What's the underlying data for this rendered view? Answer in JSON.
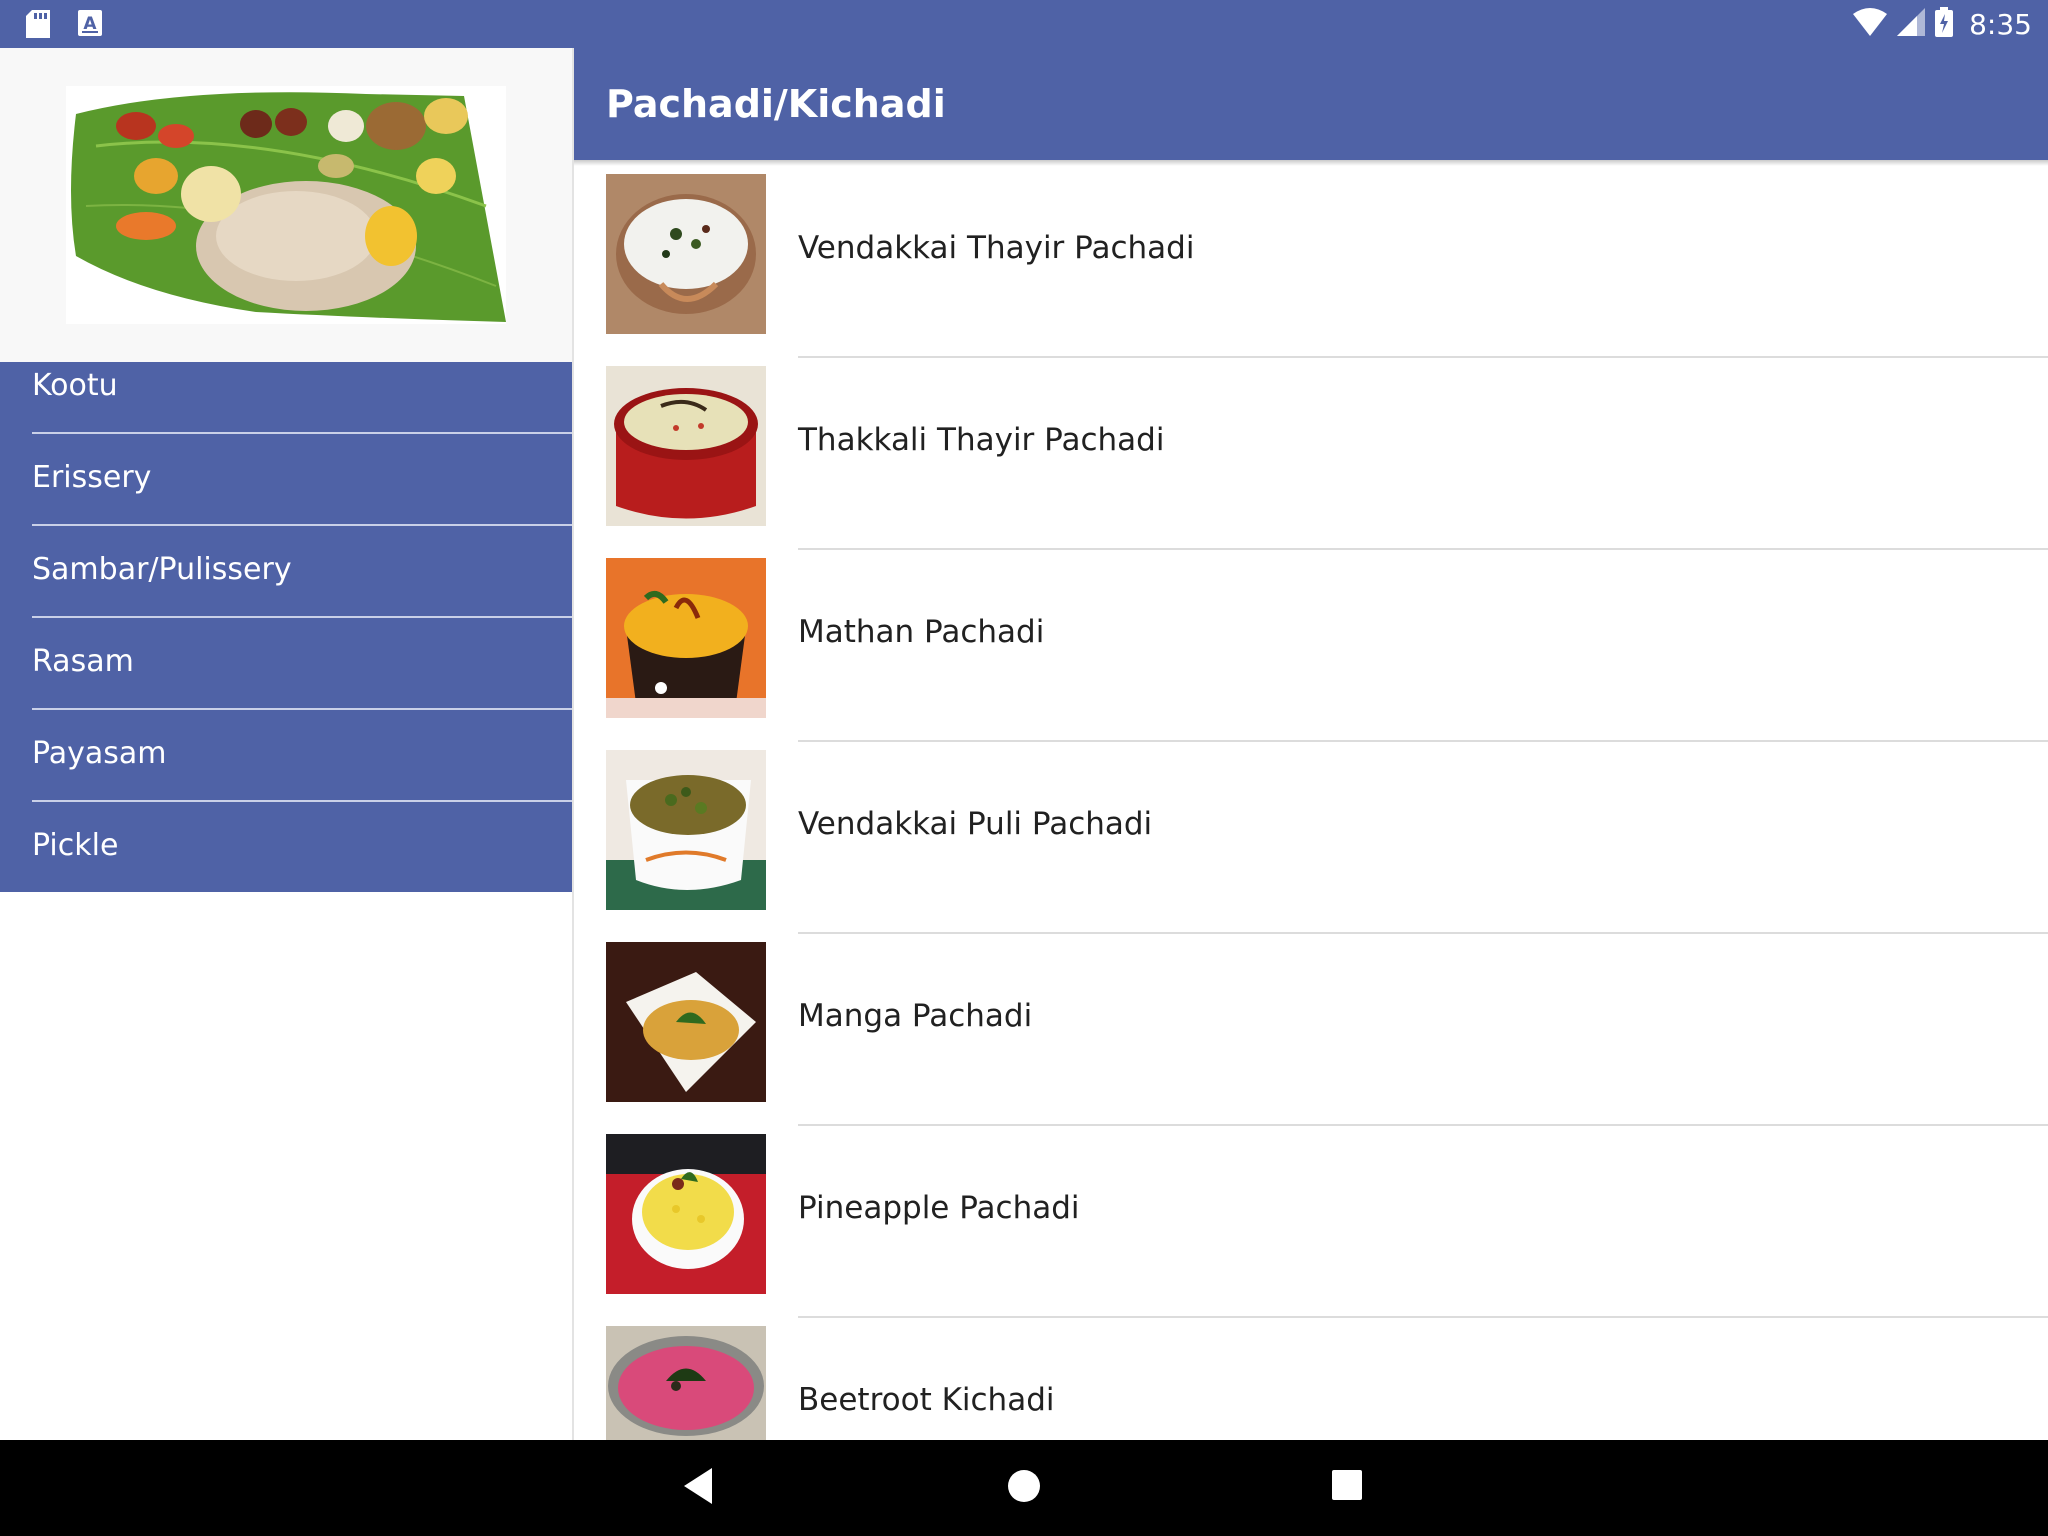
{
  "status_bar": {
    "time": "8:35",
    "icons": [
      "sd-card-icon",
      "keyboard-a-icon",
      "wifi-icon",
      "signal-icon",
      "battery-charging-icon"
    ]
  },
  "drawer": {
    "header_image": "onam-sadya-banana-leaf-image",
    "items": [
      {
        "label": "Kootu"
      },
      {
        "label": "Erissery"
      },
      {
        "label": "Sambar/Pulissery"
      },
      {
        "label": "Rasam"
      },
      {
        "label": "Payasam"
      },
      {
        "label": "Pickle"
      }
    ]
  },
  "toolbar": {
    "title": "Pachadi/Kichadi"
  },
  "recipes": [
    {
      "name": "Vendakkai Thayir Pachadi",
      "image": "curd-okra-bowl-image"
    },
    {
      "name": "Thakkali Thayir Pachadi",
      "image": "tomato-curd-pot-image"
    },
    {
      "name": "Mathan Pachadi",
      "image": "pumpkin-pachadi-image"
    },
    {
      "name": "Vendakkai Puli Pachadi",
      "image": "okra-tamarind-bowl-image"
    },
    {
      "name": "Manga Pachadi",
      "image": "mango-pachadi-image"
    },
    {
      "name": "Pineapple Pachadi",
      "image": "pineapple-pachadi-image"
    },
    {
      "name": "Beetroot Kichadi",
      "image": "beetroot-kichadi-image"
    }
  ],
  "navigation": {
    "icons": [
      "back-icon",
      "home-icon",
      "recents-icon"
    ]
  }
}
